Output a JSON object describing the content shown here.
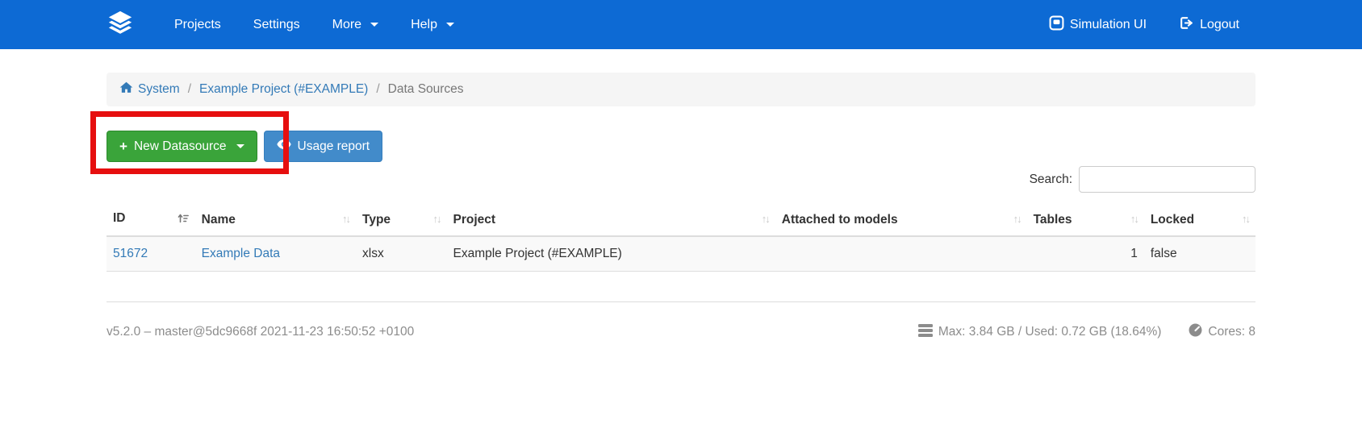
{
  "navbar": {
    "items": [
      {
        "label": "Projects"
      },
      {
        "label": "Settings"
      },
      {
        "label": "More"
      },
      {
        "label": "Help"
      }
    ],
    "simulation_ui_label": "Simulation UI",
    "logout_label": "Logout"
  },
  "breadcrumb": {
    "separator": "/",
    "items": [
      {
        "label": "System"
      },
      {
        "label": "Example Project (#EXAMPLE)"
      },
      {
        "label": "Data Sources"
      }
    ]
  },
  "toolbar": {
    "new_datasource_label": "New Datasource",
    "usage_report_label": "Usage report"
  },
  "search": {
    "label": "Search:",
    "value": ""
  },
  "table": {
    "columns": [
      {
        "label": "ID",
        "sorted": "asc"
      },
      {
        "label": "Name",
        "sorted": "none"
      },
      {
        "label": "Type",
        "sorted": "none"
      },
      {
        "label": "Project",
        "sorted": "none"
      },
      {
        "label": "Attached to models",
        "sorted": "none"
      },
      {
        "label": "Tables",
        "sorted": "none"
      },
      {
        "label": "Locked",
        "sorted": "none"
      }
    ],
    "rows": [
      {
        "id": "51672",
        "name": "Example Data",
        "type": "xlsx",
        "project": "Example Project (#EXAMPLE)",
        "attached_to_models": "",
        "tables": "1",
        "locked": "false"
      }
    ]
  },
  "footer": {
    "version": "v5.2.0 – master@5dc9668f 2021-11-23 16:50:52 +0100",
    "memory": "Max: 3.84 GB / Used: 0.72 GB (18.64%)",
    "cores": "Cores: 8"
  },
  "colors": {
    "navbar": "#0d6ad4",
    "link": "#337ab7",
    "success_button": "#3aa43a",
    "primary_button": "#428bca",
    "annotation": "#e60f0f"
  }
}
